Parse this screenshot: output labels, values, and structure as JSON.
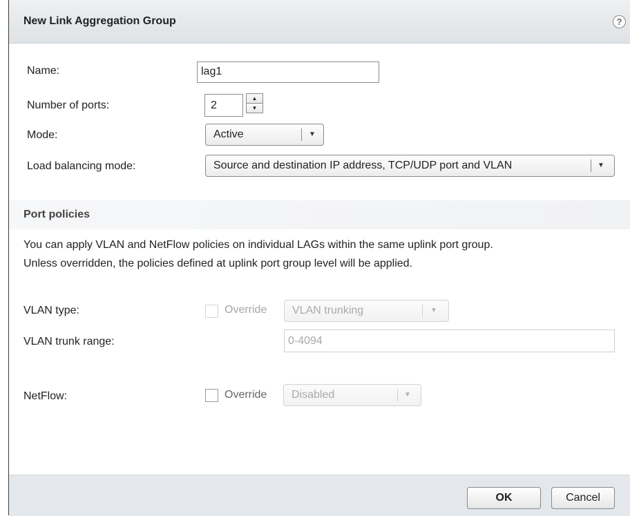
{
  "dialog": {
    "title": "New Link Aggregation Group",
    "help_glyph": "?"
  },
  "form": {
    "name_label": "Name:",
    "name_value": "lag1",
    "ports_label": "Number of ports:",
    "ports_value": "2",
    "mode_label": "Mode:",
    "mode_value": "Active",
    "lb_label": "Load balancing mode:",
    "lb_value": "Source and destination IP address, TCP/UDP port and VLAN"
  },
  "port_policies": {
    "title": "Port policies",
    "desc_line1": "You can apply VLAN and NetFlow policies on individual LAGs within the same uplink port group.",
    "desc_line2": "Unless overridden, the policies defined at uplink port group level will be applied.",
    "vlan_type_label": "VLAN type:",
    "vlan_override_label": "Override",
    "vlan_type_value": "VLAN trunking",
    "vlan_trunk_label": "VLAN trunk range:",
    "vlan_trunk_value": "0-4094",
    "netflow_label": "NetFlow:",
    "netflow_override_label": "Override",
    "netflow_value": "Disabled"
  },
  "footer": {
    "ok_label": "OK",
    "cancel_label": "Cancel"
  },
  "colors": {
    "titlebar": "#e4e8eb",
    "footer": "#e4e8ec",
    "disabled_text": "#a8a8a8"
  },
  "icons": {
    "help": "help-icon",
    "spinner_up": "spinner-up-icon",
    "spinner_down": "spinner-down-icon",
    "dropdown": "chevron-down-icon"
  }
}
